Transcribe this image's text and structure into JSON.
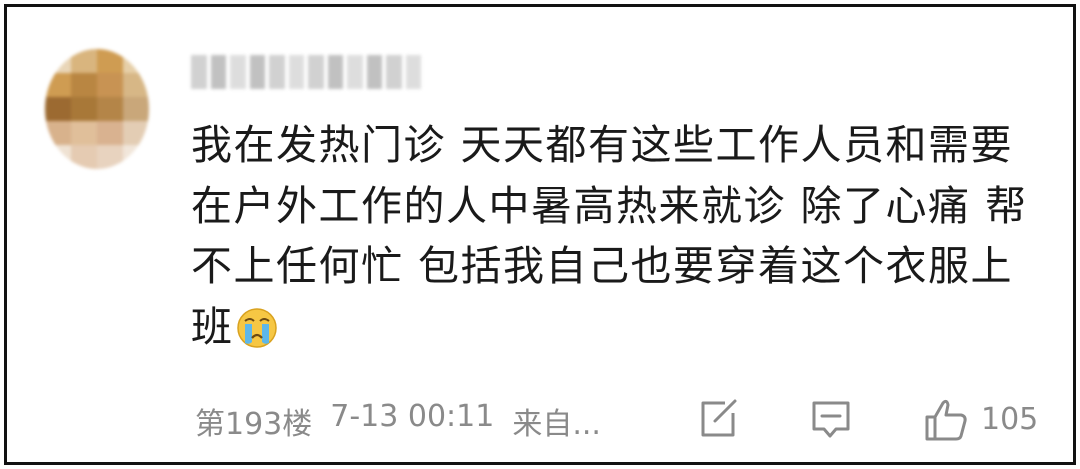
{
  "comment": {
    "text": "我在发热门诊 天天都有这些工作人员和需要在户外工作的人中暑高热来就诊 除了心痛 帮不上任何忙 包括我自己也要穿着这个衣服上班",
    "emoji": "crying-face"
  },
  "meta": {
    "floor": "第193楼",
    "time": "7-13 00:11",
    "source": "来自..."
  },
  "actions": {
    "like_count": "105"
  },
  "colors": {
    "text": "#1a1a1a",
    "meta": "#8a8a8a",
    "border": "#111111"
  }
}
